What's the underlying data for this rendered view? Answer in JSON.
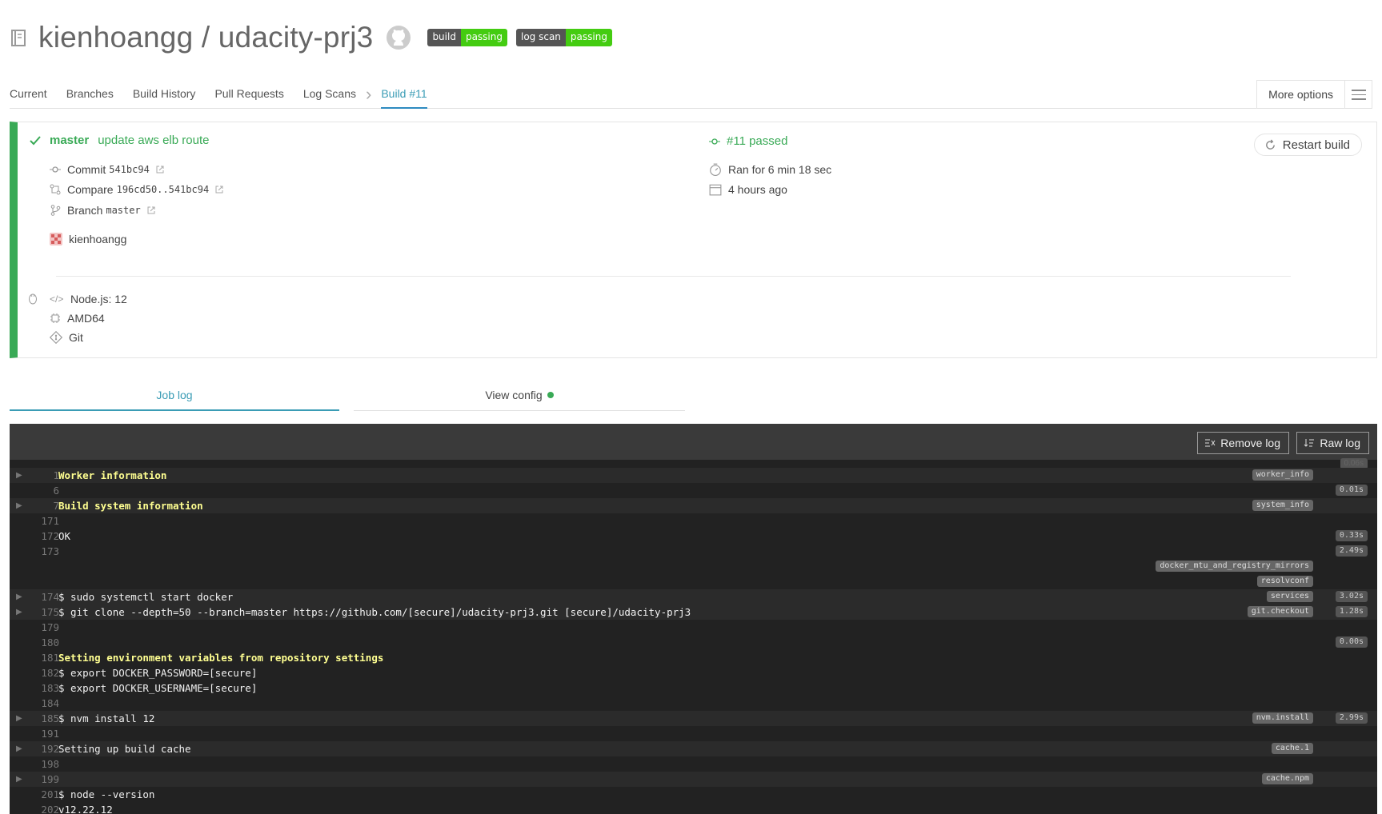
{
  "header": {
    "title": "kienhoangg / udacity-prj3",
    "badges": [
      {
        "left": "build",
        "right": "passing"
      },
      {
        "left": "log scan",
        "right": "passing"
      }
    ]
  },
  "tabs": {
    "items": [
      "Current",
      "Branches",
      "Build History",
      "Pull Requests",
      "Log Scans"
    ],
    "active": "Build #11",
    "more_options": "More options"
  },
  "build": {
    "branch": "master",
    "message": "update aws elb route",
    "commit_label": "Commit",
    "commit": "541bc94",
    "compare_label": "Compare",
    "compare": "196cd50..541bc94",
    "branch_label": "Branch",
    "branch_value": "master",
    "author": "kienhoangg",
    "status": "#11 passed",
    "duration": "Ran for 6 min 18 sec",
    "finished": "4 hours ago",
    "restart": "Restart build",
    "lang": "Node.js: 12",
    "arch": "AMD64",
    "git": "Git"
  },
  "subtabs": {
    "job_log": "Job log",
    "view_config": "View config"
  },
  "log": {
    "remove": "Remove log",
    "raw": "Raw log",
    "top_time": "0.06s",
    "lines": [
      {
        "n": "1",
        "t": "Worker information",
        "y": true,
        "fold": true,
        "tag": "worker_info",
        "time": ""
      },
      {
        "n": "6",
        "t": "",
        "y": false,
        "fold": false,
        "tag": "",
        "time": "0.01s"
      },
      {
        "n": "7",
        "t": "Build system information",
        "y": true,
        "fold": true,
        "tag": "system_info",
        "time": ""
      },
      {
        "n": "171",
        "t": "",
        "y": false,
        "fold": false,
        "tag": "",
        "time": ""
      },
      {
        "n": "172",
        "t": "OK",
        "y": false,
        "fold": false,
        "tag": "",
        "time": "0.33s"
      },
      {
        "n": "173",
        "t": "",
        "y": false,
        "fold": false,
        "tag": "",
        "time": "2.49s"
      },
      {
        "n": "",
        "t": "",
        "y": false,
        "fold": false,
        "tag": "docker_mtu_and_registry_mirrors",
        "time": ""
      },
      {
        "n": "",
        "t": "",
        "y": false,
        "fold": false,
        "tag": "resolvconf",
        "time": ""
      },
      {
        "n": "174",
        "t": "$ sudo systemctl start docker",
        "y": false,
        "fold": true,
        "tag": "services",
        "time": "3.02s"
      },
      {
        "n": "175",
        "t": "$ git clone --depth=50 --branch=master https://github.com/[secure]/udacity-prj3.git [secure]/udacity-prj3",
        "y": false,
        "fold": true,
        "tag": "git.checkout",
        "time": "1.28s"
      },
      {
        "n": "179",
        "t": "",
        "y": false,
        "fold": false,
        "tag": "",
        "time": ""
      },
      {
        "n": "180",
        "t": "",
        "y": false,
        "fold": false,
        "tag": "",
        "time": "0.00s"
      },
      {
        "n": "181",
        "t": "Setting environment variables from repository settings",
        "y": true,
        "fold": false,
        "tag": "",
        "time": ""
      },
      {
        "n": "182",
        "t": "$ export DOCKER_PASSWORD=[secure]",
        "y": false,
        "fold": false,
        "tag": "",
        "time": ""
      },
      {
        "n": "183",
        "t": "$ export DOCKER_USERNAME=[secure]",
        "y": false,
        "fold": false,
        "tag": "",
        "time": ""
      },
      {
        "n": "184",
        "t": "",
        "y": false,
        "fold": false,
        "tag": "",
        "time": ""
      },
      {
        "n": "185",
        "t": "$ nvm install 12",
        "y": false,
        "fold": true,
        "tag": "nvm.install",
        "time": "2.99s"
      },
      {
        "n": "191",
        "t": "",
        "y": false,
        "fold": false,
        "tag": "",
        "time": ""
      },
      {
        "n": "192",
        "t": "Setting up build cache",
        "y": false,
        "fold": true,
        "tag": "cache.1",
        "time": ""
      },
      {
        "n": "198",
        "t": "",
        "y": false,
        "fold": false,
        "tag": "",
        "time": ""
      },
      {
        "n": "199",
        "t": "",
        "y": false,
        "fold": true,
        "tag": "cache.npm",
        "time": ""
      },
      {
        "n": "201",
        "t": "$ node --version",
        "y": false,
        "fold": false,
        "tag": "",
        "time": ""
      },
      {
        "n": "202",
        "t": "v12.22.12",
        "y": false,
        "fold": false,
        "tag": "",
        "time": ""
      }
    ]
  }
}
